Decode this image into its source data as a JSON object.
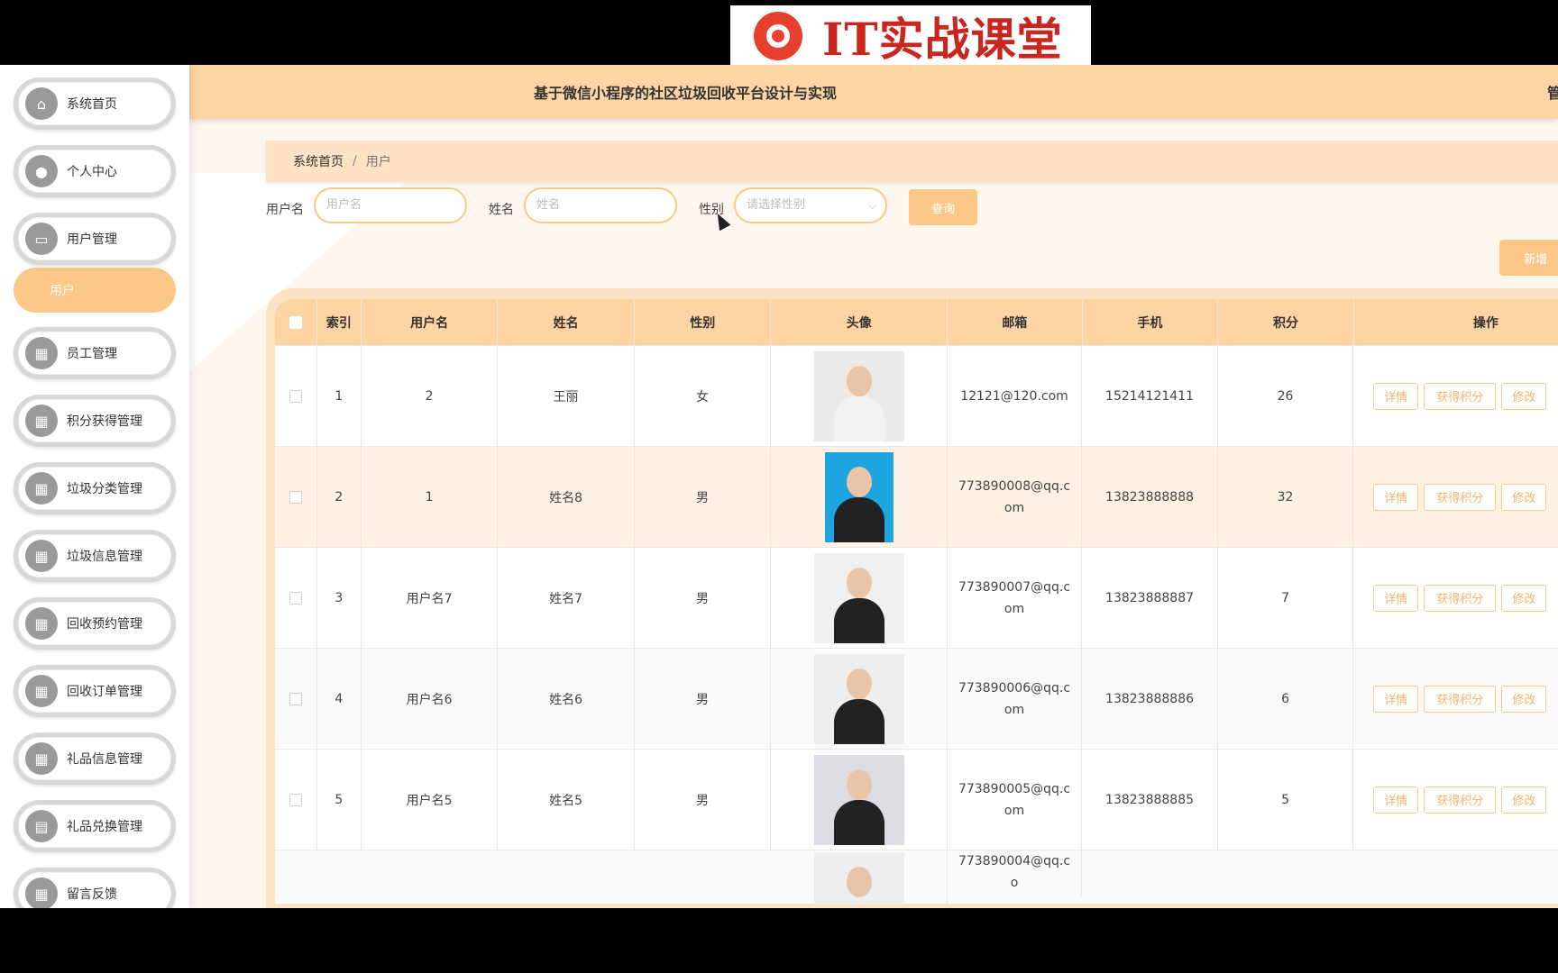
{
  "watermark": {
    "text": "IT实战课堂"
  },
  "header": {
    "title": "基于微信小程序的社区垃圾回收平台设计与实现",
    "admin_label": "管"
  },
  "sidebar": {
    "items": [
      {
        "label": "系统首页",
        "icon": "home-icon",
        "glyph": "⌂"
      },
      {
        "label": "个人中心",
        "icon": "user-icon",
        "glyph": "●"
      },
      {
        "label": "用户管理",
        "icon": "monitor-icon",
        "glyph": "▭"
      },
      {
        "label": "员工管理",
        "icon": "grid-icon",
        "glyph": "▦"
      },
      {
        "label": "积分获得管理",
        "icon": "grid-icon",
        "glyph": "▦"
      },
      {
        "label": "垃圾分类管理",
        "icon": "grid-icon",
        "glyph": "▦"
      },
      {
        "label": "垃圾信息管理",
        "icon": "grid-icon",
        "glyph": "▦"
      },
      {
        "label": "回收预约管理",
        "icon": "grid-icon",
        "glyph": "▦"
      },
      {
        "label": "回收订单管理",
        "icon": "grid-icon",
        "glyph": "▦"
      },
      {
        "label": "礼品信息管理",
        "icon": "grid-icon",
        "glyph": "▦"
      },
      {
        "label": "礼品兑换管理",
        "icon": "chat-icon",
        "glyph": "▤"
      },
      {
        "label": "留言反馈",
        "icon": "grid-icon",
        "glyph": "▦"
      }
    ],
    "active_sub": "用户"
  },
  "breadcrumb": {
    "home": "系统首页",
    "separator": "/",
    "current": "用户"
  },
  "filters": {
    "username_label": "用户名",
    "username_placeholder": "用户名",
    "name_label": "姓名",
    "name_placeholder": "姓名",
    "gender_label": "性别",
    "gender_placeholder": "请选择性别",
    "query_button": "查询",
    "add_button": "新增"
  },
  "table": {
    "columns": [
      "索引",
      "用户名",
      "姓名",
      "性别",
      "头像",
      "邮箱",
      "手机",
      "积分",
      "操作"
    ],
    "actions": [
      "详情",
      "获得积分",
      "修改"
    ],
    "rows": [
      {
        "index": "1",
        "username": "2",
        "name": "王丽",
        "gender": "女",
        "email": "12121@120.com",
        "phone": "15214121411",
        "points": "26"
      },
      {
        "index": "2",
        "username": "1",
        "name": "姓名8",
        "gender": "男",
        "email": "773890008@qq.com",
        "phone": "13823888888",
        "points": "32"
      },
      {
        "index": "3",
        "username": "用户名7",
        "name": "姓名7",
        "gender": "男",
        "email": "773890007@qq.com",
        "phone": "13823888887",
        "points": "7"
      },
      {
        "index": "4",
        "username": "用户名6",
        "name": "姓名6",
        "gender": "男",
        "email": "773890006@qq.com",
        "phone": "13823888886",
        "points": "6"
      },
      {
        "index": "5",
        "username": "用户名5",
        "name": "姓名5",
        "gender": "男",
        "email": "773890005@qq.com",
        "phone": "13823888885",
        "points": "5"
      },
      {
        "index": "",
        "username": "",
        "name": "",
        "gender": "",
        "email": "773890004@qq.co",
        "phone": "",
        "points": ""
      }
    ]
  },
  "colors": {
    "accent": "#fcc888",
    "header_bg": "#fdd5a4",
    "breadcrumb_bg": "#fde3c3",
    "main_bg": "#fff7ee"
  }
}
